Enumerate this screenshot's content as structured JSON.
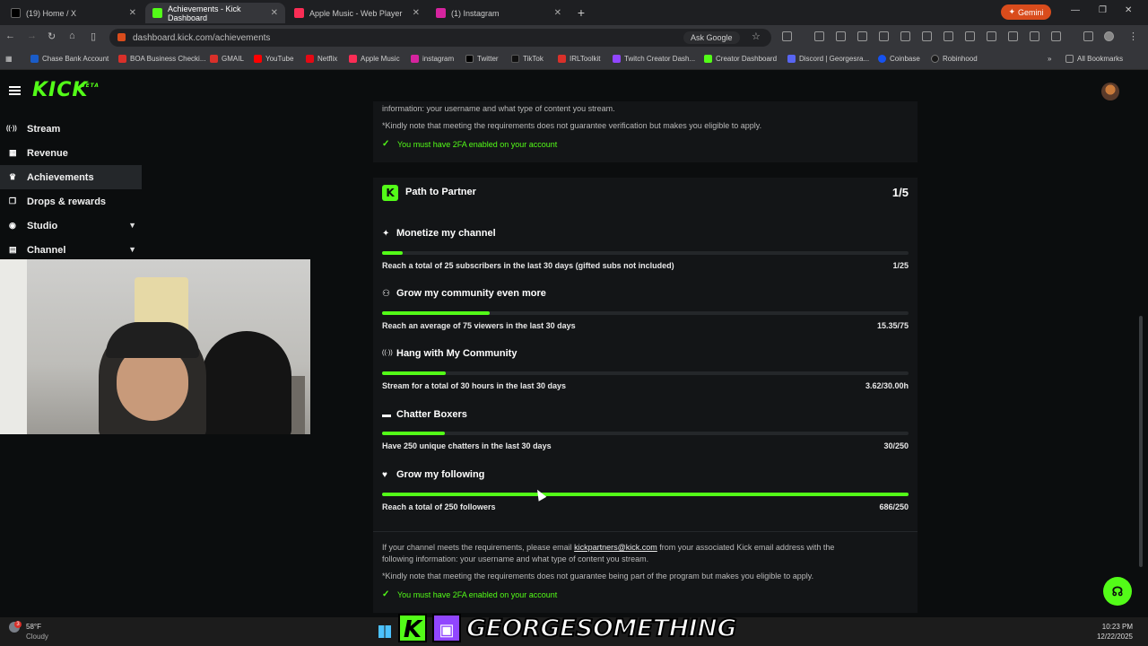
{
  "browser": {
    "tabs": [
      {
        "label": "(19) Home / X",
        "color": "#000000",
        "active": false
      },
      {
        "label": "Achievements - Kick Dashboard",
        "color": "#53fc18",
        "active": true
      },
      {
        "label": "Apple Music - Web Player",
        "color": "#fa2d55",
        "active": false
      },
      {
        "label": "(1) Instagram",
        "color": "#d6249f",
        "active": false
      }
    ],
    "gemini_label": "Gemini",
    "url": "dashboard.kick.com/achievements",
    "ask_google": "Ask Google",
    "bookmarks": [
      {
        "label": "Chase Bank Account",
        "color": "#1a5cc8"
      },
      {
        "label": "BOA Business Checki...",
        "color": "#d9302a"
      },
      {
        "label": "GMAIL",
        "color": "#d9302a"
      },
      {
        "label": "YouTube",
        "color": "#ff0000"
      },
      {
        "label": "Netflix",
        "color": "#e50914"
      },
      {
        "label": "Apple Music",
        "color": "#fa2d55"
      },
      {
        "label": "instagram",
        "color": "#d6249f"
      },
      {
        "label": "Twitter",
        "color": "#000000"
      },
      {
        "label": "TikTok",
        "color": "#111111"
      },
      {
        "label": "IRLToolkit",
        "color": "#d9302a"
      },
      {
        "label": "Twitch Creator Dash...",
        "color": "#9146ff"
      },
      {
        "label": "Creator Dashboard",
        "color": "#53fc18"
      },
      {
        "label": "Discord | Georgesra...",
        "color": "#5865f2"
      },
      {
        "label": "Coinbase",
        "color": "#1652f0"
      },
      {
        "label": "Robinhood",
        "color": "#1a1a1a"
      }
    ],
    "all_bookmarks": "All Bookmarks"
  },
  "sidebar": {
    "items": [
      {
        "label": "Stream",
        "icon": "broadcast-icon",
        "glyph": "((·))",
        "active": false,
        "chevron": false
      },
      {
        "label": "Revenue",
        "icon": "revenue-icon",
        "glyph": "▦",
        "active": false,
        "chevron": false
      },
      {
        "label": "Achievements",
        "icon": "trophy-icon",
        "glyph": "♛",
        "active": true,
        "chevron": false
      },
      {
        "label": "Drops & rewards",
        "icon": "gift-icon",
        "glyph": "❒",
        "active": false,
        "chevron": false
      },
      {
        "label": "Studio",
        "icon": "studio-icon",
        "glyph": "◉",
        "active": false,
        "chevron": true
      },
      {
        "label": "Channel",
        "icon": "channel-icon",
        "glyph": "▤",
        "active": false,
        "chevron": true
      }
    ]
  },
  "top_card": {
    "partial_line": "information: your username and what type of content you stream.",
    "note": "*Kindly note that meeting the requirements does not guarantee verification but makes you eligible to apply.",
    "twofa": "You must have 2FA enabled on your account"
  },
  "path_to_partner": {
    "icon_letter": "K",
    "title": "Path to Partner",
    "count": "1/5",
    "goals": [
      {
        "title": "Monetize my channel",
        "icon": "sparkle-icon",
        "glyph": "✦",
        "desc": "Reach a total of 25 subscribers in the last 30 days (gifted subs not included)",
        "value": "1/25",
        "progress": 0.04
      },
      {
        "title": "Grow my community even more",
        "icon": "users-icon",
        "glyph": "⚇",
        "desc": "Reach an average of 75 viewers in the last 30 days",
        "value": "15.35/75",
        "progress": 0.2047
      },
      {
        "title": "Hang with My Community",
        "icon": "live-icon",
        "glyph": "((·))",
        "desc": "Stream for a total of 30 hours in the last 30 days",
        "value": "3.62/30.00h",
        "progress": 0.1207
      },
      {
        "title": "Chatter Boxers",
        "icon": "chat-icon",
        "glyph": "▬",
        "desc": "Have 250 unique chatters in the last 30 days",
        "value": "30/250",
        "progress": 0.12
      },
      {
        "title": "Grow my following",
        "icon": "heart-icon",
        "glyph": "♥",
        "desc": "Reach a total of 250 followers",
        "value": "686/250",
        "progress": 1.0
      }
    ],
    "footer_pre": "If your channel meets the requirements, please email ",
    "footer_email": "kickpartners@kick.com",
    "footer_post": " from your associated Kick email address with the",
    "footer_line2": "following information: your username and what type of content you stream.",
    "note": "*Kindly note that meeting the requirements does not guarantee being part of the program but makes you eligible to apply.",
    "twofa": "You must have 2FA enabled on your account"
  },
  "taskbar": {
    "weather_temp": "58°F",
    "weather_desc": "Cloudy",
    "weather_badge": "3",
    "overlay_name": "GEORGESOMETHING",
    "time": "10:23 PM",
    "date": "12/22/2025"
  },
  "colors": {
    "kick_green": "#53fc18",
    "background": "#0b0d0e",
    "card": "#131517"
  }
}
